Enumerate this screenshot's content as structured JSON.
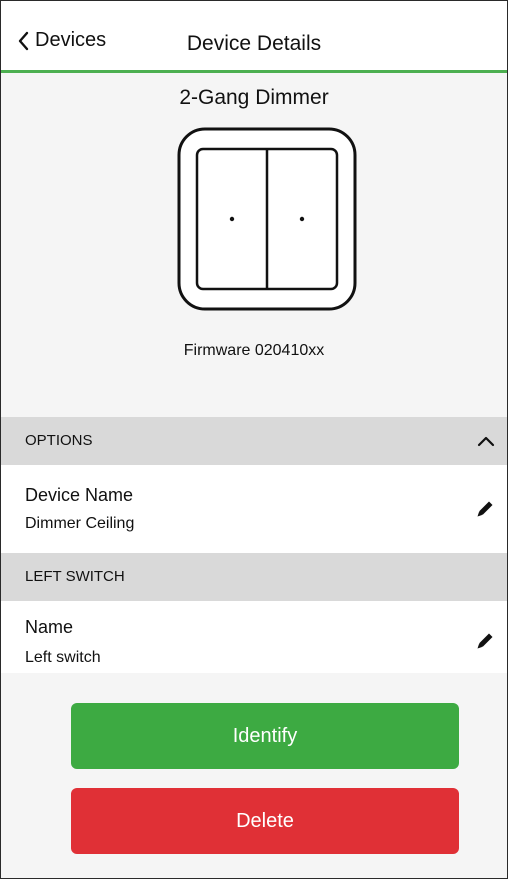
{
  "header": {
    "back_label": "Devices",
    "title": "Device Details"
  },
  "device": {
    "type": "2-Gang Dimmer",
    "firmware": "Firmware 020410xx",
    "icon": "two-gang-switch-illustration"
  },
  "options_section": {
    "label": "OPTIONS",
    "icon": "chevron-up-icon",
    "device_name_label": "Device Name",
    "device_name_value": "Dimmer Ceiling"
  },
  "left_switch_section": {
    "label": "LEFT SWITCH",
    "name_label": "Name",
    "name_value": "Left switch"
  },
  "actions": {
    "identify_label": "Identify",
    "delete_label": "Delete"
  },
  "colors": {
    "accent_green": "#4caf50",
    "identify_green": "#3daa42",
    "delete_red": "#e03036",
    "section_gray": "#d9d9d9"
  }
}
